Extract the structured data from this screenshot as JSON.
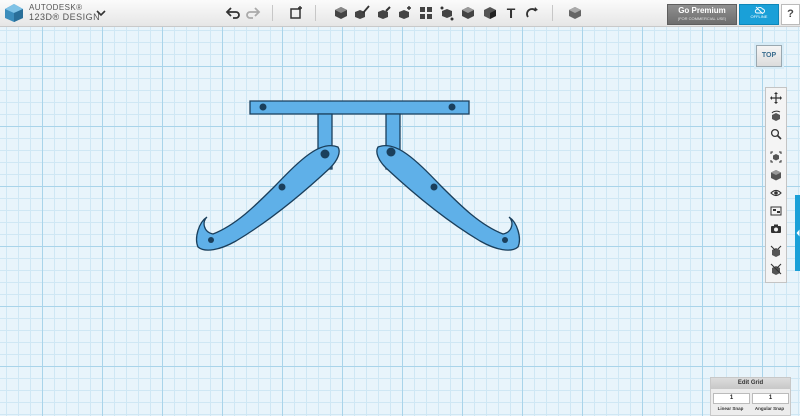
{
  "app": {
    "brand_top": "AUTODESK®",
    "brand_bottom": "123D® DESIGN",
    "brand_color": "#1aa0d8",
    "menu_icon": "chevron-down-icon"
  },
  "toolbar": {
    "icons": [
      "undo-icon",
      "redo-icon",
      "transform-icon",
      "primitives-icon",
      "sketch-icon",
      "construct-icon",
      "modify-icon",
      "pattern-icon",
      "grouping-icon",
      "combine-icon",
      "measure-icon",
      "text-icon",
      "snap-icon",
      "material-icon"
    ],
    "text_tool_label": "T"
  },
  "account": {
    "premium_title": "Go Premium",
    "premium_subtitle": "(FOR COMMERCIAL USE)",
    "offline_label": "OFFLINE",
    "help_label": "?"
  },
  "viewcube": {
    "label": "TOP"
  },
  "navbar": {
    "icons": [
      "pan-icon",
      "orbit-icon",
      "zoom-icon",
      "fit-icon",
      "view-icon",
      "visibility-icon",
      "materials-icon",
      "camera-icon",
      "outline-icon",
      "grid-icon"
    ]
  },
  "edit_grid": {
    "title": "Edit Grid",
    "linear_snap_value": "1",
    "angular_snap_value": "1",
    "linear_snap_label": "Linear Snap",
    "angular_snap_label": "Angular Snap"
  },
  "colors": {
    "grid_major": "#a9d4ea",
    "grid_minor": "#cfe7f4",
    "model_fill": "#5fb0e8",
    "model_stroke": "#1a3f5c",
    "accent": "#1aa0d8"
  }
}
